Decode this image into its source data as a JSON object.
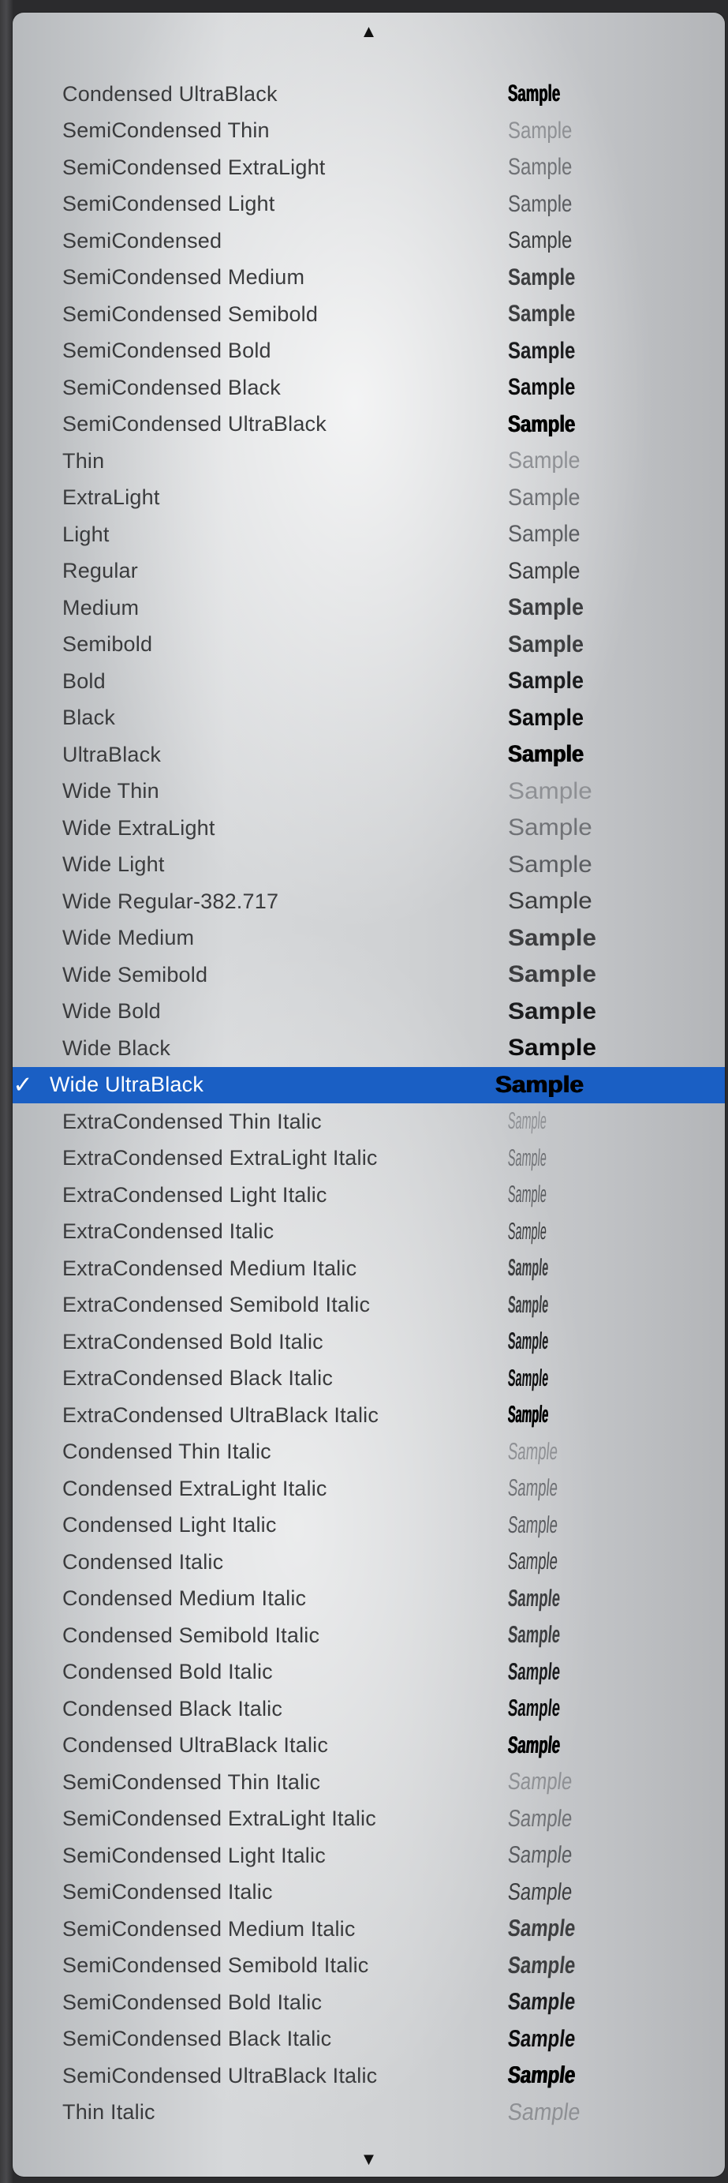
{
  "menu": {
    "scroll_up_icon": "▲",
    "scroll_down_icon": "▼",
    "selected_check": "✓",
    "sample_text": "Sample",
    "items": [
      {
        "label": "Condensed UltraBlack",
        "weight": "ultra",
        "width": "cond"
      },
      {
        "label": "SemiCondensed Thin",
        "weight": "thin",
        "width": "semi"
      },
      {
        "label": "SemiCondensed ExtraLight",
        "weight": "xlight",
        "width": "semi"
      },
      {
        "label": "SemiCondensed Light",
        "weight": "light",
        "width": "semi"
      },
      {
        "label": "SemiCondensed",
        "weight": "reg",
        "width": "semi"
      },
      {
        "label": "SemiCondensed Medium",
        "weight": "med",
        "width": "semi"
      },
      {
        "label": "SemiCondensed Semibold",
        "weight": "semi",
        "width": "semi"
      },
      {
        "label": "SemiCondensed Bold",
        "weight": "bold",
        "width": "semi"
      },
      {
        "label": "SemiCondensed Black",
        "weight": "black",
        "width": "semi"
      },
      {
        "label": "SemiCondensed UltraBlack",
        "weight": "ultra",
        "width": "semi"
      },
      {
        "label": "Thin",
        "weight": "thin",
        "width": "norm"
      },
      {
        "label": "ExtraLight",
        "weight": "xlight",
        "width": "norm"
      },
      {
        "label": "Light",
        "weight": "light",
        "width": "norm"
      },
      {
        "label": "Regular",
        "weight": "reg",
        "width": "norm"
      },
      {
        "label": "Medium",
        "weight": "med",
        "width": "norm"
      },
      {
        "label": "Semibold",
        "weight": "semi",
        "width": "norm"
      },
      {
        "label": "Bold",
        "weight": "bold",
        "width": "norm"
      },
      {
        "label": "Black",
        "weight": "black",
        "width": "norm"
      },
      {
        "label": "UltraBlack",
        "weight": "ultra",
        "width": "norm"
      },
      {
        "label": "Wide Thin",
        "weight": "thin",
        "width": "wide"
      },
      {
        "label": "Wide ExtraLight",
        "weight": "xlight",
        "width": "wide"
      },
      {
        "label": "Wide Light",
        "weight": "light",
        "width": "wide"
      },
      {
        "label": "Wide Regular-382.717",
        "weight": "reg",
        "width": "wide"
      },
      {
        "label": "Wide Medium",
        "weight": "med",
        "width": "wide"
      },
      {
        "label": "Wide Semibold",
        "weight": "semi",
        "width": "wide"
      },
      {
        "label": "Wide Bold",
        "weight": "bold",
        "width": "wide"
      },
      {
        "label": "Wide Black",
        "weight": "black",
        "width": "wide"
      },
      {
        "label": "Wide UltraBlack",
        "weight": "ultra",
        "width": "wide",
        "selected": true
      },
      {
        "label": "ExtraCondensed Thin Italic",
        "weight": "thin",
        "width": "xcond"
      },
      {
        "label": "ExtraCondensed ExtraLight Italic",
        "weight": "xlight",
        "width": "xcond"
      },
      {
        "label": "ExtraCondensed Light Italic",
        "weight": "light",
        "width": "xcond"
      },
      {
        "label": "ExtraCondensed Italic",
        "weight": "reg",
        "width": "xcond"
      },
      {
        "label": "ExtraCondensed Medium Italic",
        "weight": "med",
        "width": "xcond"
      },
      {
        "label": "ExtraCondensed Semibold Italic",
        "weight": "semi",
        "width": "xcond"
      },
      {
        "label": "ExtraCondensed Bold Italic",
        "weight": "bold",
        "width": "xcond"
      },
      {
        "label": "ExtraCondensed Black Italic",
        "weight": "black",
        "width": "xcond"
      },
      {
        "label": "ExtraCondensed UltraBlack Italic",
        "weight": "ultra",
        "width": "xcond"
      },
      {
        "label": "Condensed Thin Italic",
        "weight": "thin",
        "width": "condi"
      },
      {
        "label": "Condensed ExtraLight Italic",
        "weight": "xlight",
        "width": "condi"
      },
      {
        "label": "Condensed Light Italic",
        "weight": "light",
        "width": "condi"
      },
      {
        "label": "Condensed Italic",
        "weight": "reg",
        "width": "condi"
      },
      {
        "label": "Condensed Medium Italic",
        "weight": "med",
        "width": "condi"
      },
      {
        "label": "Condensed Semibold Italic",
        "weight": "semi",
        "width": "condi"
      },
      {
        "label": "Condensed Bold Italic",
        "weight": "bold",
        "width": "condi"
      },
      {
        "label": "Condensed Black Italic",
        "weight": "black",
        "width": "condi"
      },
      {
        "label": "Condensed UltraBlack Italic",
        "weight": "ultra",
        "width": "condi"
      },
      {
        "label": "SemiCondensed Thin Italic",
        "weight": "thin",
        "width": "semii"
      },
      {
        "label": "SemiCondensed ExtraLight Italic",
        "weight": "xlight",
        "width": "semii"
      },
      {
        "label": "SemiCondensed Light Italic",
        "weight": "light",
        "width": "semii"
      },
      {
        "label": "SemiCondensed Italic",
        "weight": "reg",
        "width": "semii"
      },
      {
        "label": "SemiCondensed Medium Italic",
        "weight": "med",
        "width": "semii"
      },
      {
        "label": "SemiCondensed Semibold Italic",
        "weight": "semi",
        "width": "semii"
      },
      {
        "label": "SemiCondensed Bold Italic",
        "weight": "bold",
        "width": "semii"
      },
      {
        "label": "SemiCondensed Black Italic",
        "weight": "black",
        "width": "semii"
      },
      {
        "label": "SemiCondensed UltraBlack Italic",
        "weight": "ultra",
        "width": "semii"
      },
      {
        "label": "Thin Italic",
        "weight": "thin",
        "width": "normi"
      }
    ]
  },
  "colors": {
    "selection": "#1a5fc4",
    "label_text": "#3a3b3d"
  }
}
